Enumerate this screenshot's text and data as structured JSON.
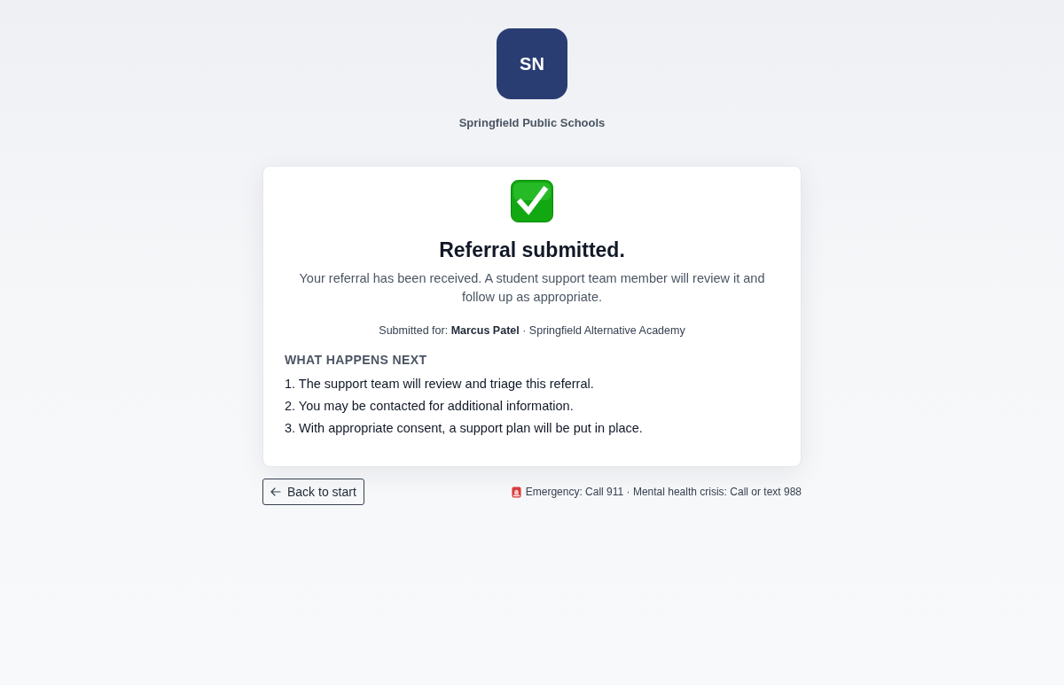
{
  "header": {
    "logo_initials": "SN",
    "organization": "Springfield Public Schools"
  },
  "confirmation": {
    "title": "Referral submitted.",
    "message": "Your referral has been received. A student support team member will review it and follow up as appropriate.",
    "submitted_for": "Submitted for: **Marcus Patel** · Springfield Alternative Academy"
  },
  "next_steps": {
    "heading": "WHAT HAPPENS NEXT",
    "items": [
      "1. The support team will review and triage this referral.",
      "2. You may be contacted for additional information.",
      "3. With appropriate consent, a support plan will be put in place."
    ]
  },
  "footer": {
    "back_button": "Back to start",
    "emergency_note": "Emergency: Call 911 · Mental health crisis: Call or text 988"
  }
}
